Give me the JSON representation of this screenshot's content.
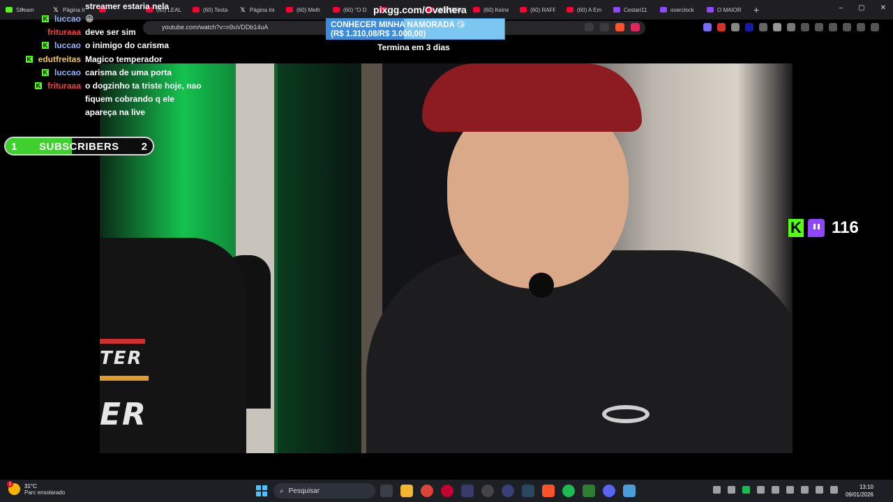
{
  "browser": {
    "tabs": [
      {
        "title": "Stream",
        "favicon": "kick"
      },
      {
        "title": "Página Ir",
        "favicon": "x"
      },
      {
        "title": "",
        "favicon": "youtube"
      },
      {
        "title": "(60) LEAL",
        "favicon": "youtube"
      },
      {
        "title": "(60) Testa",
        "favicon": "youtube"
      },
      {
        "title": "Página Ini",
        "favicon": "x"
      },
      {
        "title": "(60) Melh",
        "favicon": "youtube"
      },
      {
        "title": "(60) \"O D",
        "favicon": "youtube"
      },
      {
        "title": "",
        "favicon": "youtube"
      },
      {
        "title": "(60) TERM",
        "favicon": "youtube"
      },
      {
        "title": "(60) Keine",
        "favicon": "youtube"
      },
      {
        "title": "(60) RAFF",
        "favicon": "youtube"
      },
      {
        "title": "(60) A Em",
        "favicon": "youtube"
      },
      {
        "title": "Cestari11",
        "favicon": "twitch"
      },
      {
        "title": "overclock",
        "favicon": "twitch"
      },
      {
        "title": "O MAIOR",
        "favicon": "twitch"
      }
    ],
    "new_tab": "+",
    "url": "youtube.com/watch?v=n9uVDDb14uA",
    "window_controls": {
      "minimize": "–",
      "maximize": "▢",
      "close": "✕"
    }
  },
  "chat": [
    {
      "user": "",
      "text": "streamer estaria nela",
      "user_color": "#ffffff",
      "badge": false
    },
    {
      "user": "luccao",
      "text": "😁",
      "user_color": "#8fb6ff",
      "badge": true
    },
    {
      "user": "frituraaa",
      "text": "deve ser sim",
      "user_color": "#ff3b3b",
      "badge": false
    },
    {
      "user": "luccao",
      "text": "o inimigo do carisma",
      "user_color": "#8fb6ff",
      "badge": true
    },
    {
      "user": "edutfreitas",
      "text": "Magico temperador",
      "user_color": "#f2c94c",
      "badge": true
    },
    {
      "user": "luccao",
      "text": "carisma de uma porta",
      "user_color": "#8fb6ff",
      "badge": true
    },
    {
      "user": "frituraaa",
      "text": "o dogzinho ta triste hoje, nao fiquem cobrando q ele apareça na live",
      "user_color": "#ff3b3b",
      "badge": true
    }
  ],
  "sub_goal": {
    "current_level": "1",
    "label": "SUBSCRIBERS",
    "next_level": "2",
    "progress": 0.45,
    "fill_color": "#3ed12e"
  },
  "donation_goal": {
    "site": "pixgg.com/Ovelhera",
    "title": "CONHECER MINHA NAMORADA 😘",
    "amount": "(R$ 1.310,08/R$ 3.000,00)",
    "progress": 0.437,
    "ends": "Termina em 3 dias"
  },
  "viewers": {
    "count": "116",
    "kick_icon": "kick-icon",
    "twitch_icon": "twitch-icon"
  },
  "video": {
    "jersey_text": "TER",
    "jersey_text2": "ER"
  },
  "taskbar": {
    "weather": {
      "temp": "31°C",
      "desc": "Parc ensolarado",
      "badge": "1"
    },
    "search_placeholder": "Pesquisar",
    "clock": {
      "time": "13:10",
      "date": "09/01/2026"
    }
  },
  "colors": {
    "kick": "#53fc18",
    "twitch": "#9146ff",
    "youtube": "#ff0033"
  }
}
